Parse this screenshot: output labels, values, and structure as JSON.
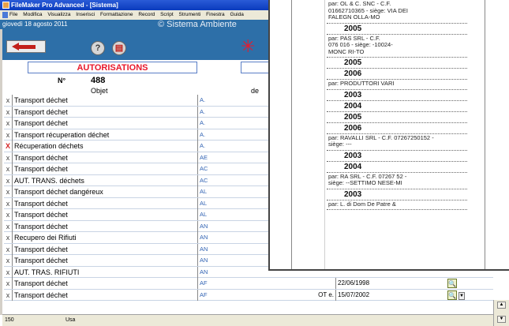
{
  "window": {
    "title": "FileMaker Pro Advanced - [Sistema]"
  },
  "menu": [
    "File",
    "Modifica",
    "Visualizza",
    "Inserisci",
    "Formattazione",
    "Record",
    "Script",
    "Strumenti",
    "Finestra",
    "Guida"
  ],
  "info": {
    "date": "giovedì 18 agosto 2011",
    "system": "© Sistema Ambiente"
  },
  "nav": {
    "help_icon": "?",
    "back_icon": "arrow-left-icon",
    "star_icon": "✳"
  },
  "form": {
    "title": "AUTORISATIONS",
    "number_label": "N°",
    "number_value": "488",
    "object_label": "Objet",
    "de_label": "de"
  },
  "rows": [
    {
      "mark": "x",
      "object": "Transport déchet",
      "code": "A.",
      "client": "",
      "date1": "",
      "date2": ""
    },
    {
      "mark": "x",
      "object": "Transport déchet",
      "code": "A.",
      "client": "",
      "date1": "",
      "date2": ""
    },
    {
      "mark": "x",
      "object": "Transport déchet",
      "code": "A.",
      "client": "",
      "date1": "",
      "date2": ""
    },
    {
      "mark": "x",
      "object": "Transport récuperation déchet",
      "code": "A.",
      "client": "",
      "date1": "",
      "date2": ""
    },
    {
      "mark": "X",
      "object": "Récuperation déchets",
      "code": "A.",
      "client": "",
      "date1": "",
      "date2": "",
      "red": true
    },
    {
      "mark": "x",
      "object": "Transport déchet",
      "code": "AE",
      "client": "",
      "date1": "",
      "date2": ""
    },
    {
      "mark": "x",
      "object": "Transport déchet",
      "code": "AC",
      "client": "",
      "date1": "",
      "date2": ""
    },
    {
      "mark": "x",
      "object": "AUT. TRANS. déchets",
      "code": "AC",
      "client": "",
      "date1": "",
      "date2": ""
    },
    {
      "mark": "x",
      "object": "Transport déchet dangéreux",
      "code": "AL",
      "client": "",
      "date1": "",
      "date2": ""
    },
    {
      "mark": "x",
      "object": "Transport déchet",
      "code": "AL",
      "client": "",
      "date1": "",
      "date2": ""
    },
    {
      "mark": "x",
      "object": "Transport déchet",
      "code": "AL",
      "client": "",
      "date1": "",
      "date2": ""
    },
    {
      "mark": "x",
      "object": "Transport déchet",
      "code": "AN",
      "client": "",
      "date1": "",
      "date2": ""
    },
    {
      "mark": "x",
      "object": "Recupero dei Rifiuti",
      "code": "AN",
      "client": "",
      "date1": "",
      "date2": ""
    },
    {
      "mark": "x",
      "object": "Transport déchet",
      "code": "AN",
      "client": "",
      "date1": "",
      "date2": ""
    },
    {
      "mark": "x",
      "object": "Transport déchet",
      "code": "AN",
      "client": "",
      "date1": "",
      "date2": ""
    },
    {
      "mark": "x",
      "object": "AUT. TRAS. RIFIUTI",
      "code": "AN",
      "client": "",
      "date1": "",
      "date2": ""
    },
    {
      "mark": "x",
      "object": "Transport déchet",
      "code": "AF",
      "client": "",
      "date1": "22/06/1998",
      "date2": ""
    },
    {
      "mark": "x",
      "object": "Transport déchet",
      "code": "AF",
      "client": "OT e.",
      "date1": "15/07/2002",
      "date2": ""
    }
  ],
  "status": {
    "zoom": "150",
    "mode": "Usa"
  },
  "popup": {
    "entries": [
      {
        "type": "item",
        "text": "par: OL                   & C. SNC - C.F.\n01662710365 - siège: VIA DEI\nFALEGN            OLLA-MO"
      },
      {
        "type": "year",
        "text": "2005"
      },
      {
        "type": "item",
        "text": "par: PAS          SRL - C.F.\n076          016 - siège: -10024-\nMONC        RI-TO"
      },
      {
        "type": "year",
        "text": "2005"
      },
      {
        "type": "year",
        "text": "2006"
      },
      {
        "type": "item",
        "text": "par: PRODUTTORI VARI"
      },
      {
        "type": "year",
        "text": "2003"
      },
      {
        "type": "year",
        "text": "2004"
      },
      {
        "type": "year",
        "text": "2005"
      },
      {
        "type": "year",
        "text": "2006"
      },
      {
        "type": "item",
        "text": "par: RAVALLI SRL - C.F. 07267250152 -\nsiège: ---"
      },
      {
        "type": "year",
        "text": "2003"
      },
      {
        "type": "year",
        "text": "2004"
      },
      {
        "type": "item",
        "text": "par: RA          SRL - C.F. 07267      52 -\nsiège: --SETTIMO       NESE-MI"
      },
      {
        "type": "year",
        "text": "2003"
      },
      {
        "type": "item",
        "text": "par:          L. di Dom        De Patre &"
      }
    ]
  }
}
